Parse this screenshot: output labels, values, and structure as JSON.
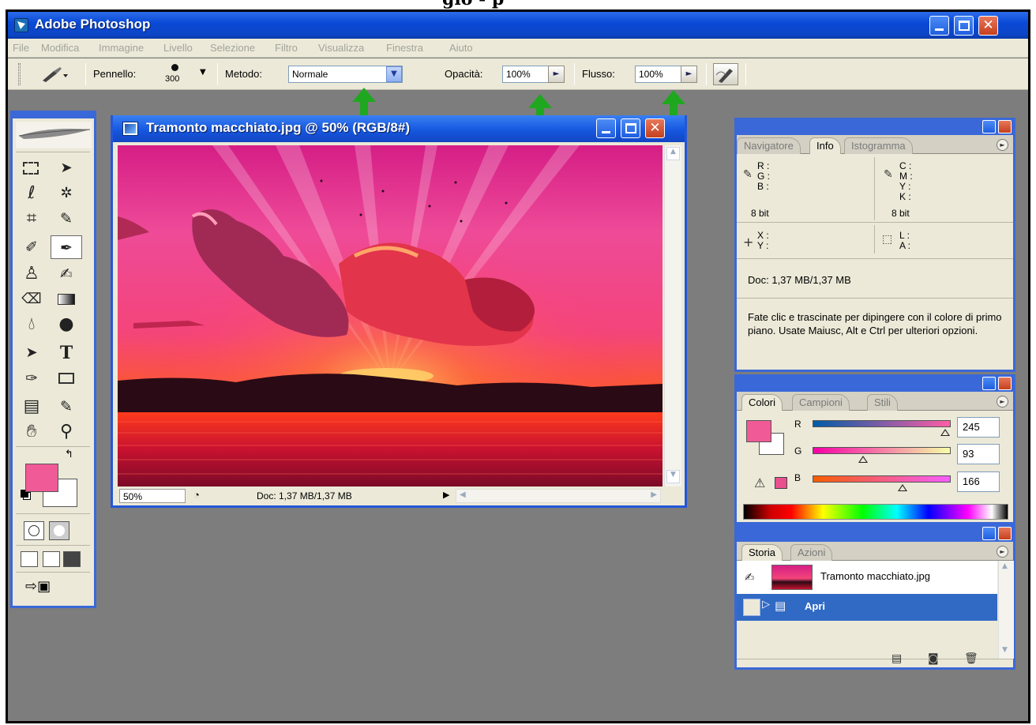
{
  "page_heading_fragment": "gio - p",
  "app": {
    "title": "Adobe Photoshop"
  },
  "menu": [
    "File",
    "Modifica",
    "Immagine",
    "Livello",
    "Selezione",
    "Filtro",
    "Visualizza",
    "Finestra",
    "Aiuto"
  ],
  "options": {
    "brush_label": "Pennello:",
    "brush_size": "300",
    "mode_label": "Metodo:",
    "mode_value": "Normale",
    "opacity_label": "Opacità:",
    "opacity_value": "100%",
    "flow_label": "Flusso:",
    "flow_value": "100%"
  },
  "document": {
    "title": "Tramonto macchiato.jpg @ 50% (RGB/8#)",
    "zoom": "50%",
    "doc_size": "Doc: 1,37 MB/1,37 MB"
  },
  "info_palette": {
    "tabs": [
      "Navigatore",
      "Info",
      "Istogramma"
    ],
    "rgb_labels": [
      "R :",
      "G :",
      "B :"
    ],
    "cmyk_labels": [
      "C :",
      "M :",
      "Y :",
      "K :"
    ],
    "bits_left": "8 bit",
    "bits_right": "8 bit",
    "xy_labels": [
      "X :",
      "Y :"
    ],
    "la_labels": [
      "L :",
      "A :"
    ],
    "doc_size": "Doc: 1,37 MB/1,37 MB",
    "hint": "Fate clic e trascinate per dipingere con il colore di primo piano. Usate Maiusc, Alt e Ctrl per ulteriori opzioni."
  },
  "color_palette": {
    "tabs": [
      "Colori",
      "Campioni",
      "Stili"
    ],
    "channels": [
      {
        "label": "R",
        "value": "245",
        "fraction": 0.961
      },
      {
        "label": "G",
        "value": "93",
        "fraction": 0.365
      },
      {
        "label": "B",
        "value": "166",
        "fraction": 0.651
      }
    ],
    "foreground": "#f55da6",
    "background": "#ffffff"
  },
  "history_palette": {
    "tabs": [
      "Storia",
      "Azioni"
    ],
    "snapshot_name": "Tramonto macchiato.jpg",
    "step": "Apri"
  },
  "colors": {
    "xp_blue": "#0a4ad6",
    "selection_blue": "#316ac5",
    "arrow_green": "#1fa81f"
  }
}
